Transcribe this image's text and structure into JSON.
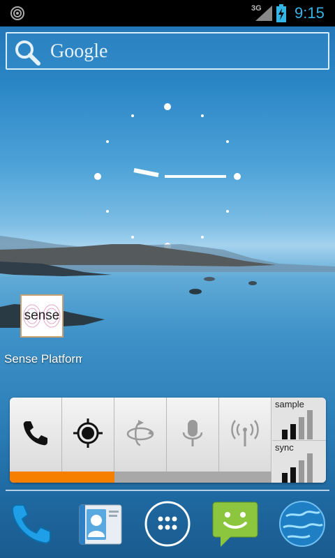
{
  "status_bar": {
    "network_type": "3G",
    "time": "9:15",
    "icons": [
      "target-notification-icon",
      "signal-icon",
      "battery-charging-icon"
    ]
  },
  "search": {
    "label": "Google",
    "icon": "search-icon"
  },
  "clock": {
    "type": "analog",
    "time": "9:15"
  },
  "app": {
    "icon_text": "sense",
    "label": "Sense Platform"
  },
  "widget": {
    "buttons": [
      {
        "name": "phone",
        "icon": "phone-icon",
        "state": "on"
      },
      {
        "name": "gps",
        "icon": "gps-icon",
        "state": "on"
      },
      {
        "name": "rotate",
        "icon": "rotate-icon",
        "state": "off"
      },
      {
        "name": "microphone",
        "icon": "microphone-icon",
        "state": "off"
      },
      {
        "name": "wireless",
        "icon": "antenna-icon",
        "state": "off"
      }
    ],
    "status": [
      {
        "label": "sample"
      },
      {
        "label": "sync"
      }
    ],
    "accent_color": "#f77f00"
  },
  "dock": {
    "items": [
      "phone-app-icon",
      "contacts-icon",
      "all-apps-icon",
      "messaging-icon",
      "browser-icon"
    ]
  },
  "colors": {
    "time_accent": "#33b5e5"
  }
}
